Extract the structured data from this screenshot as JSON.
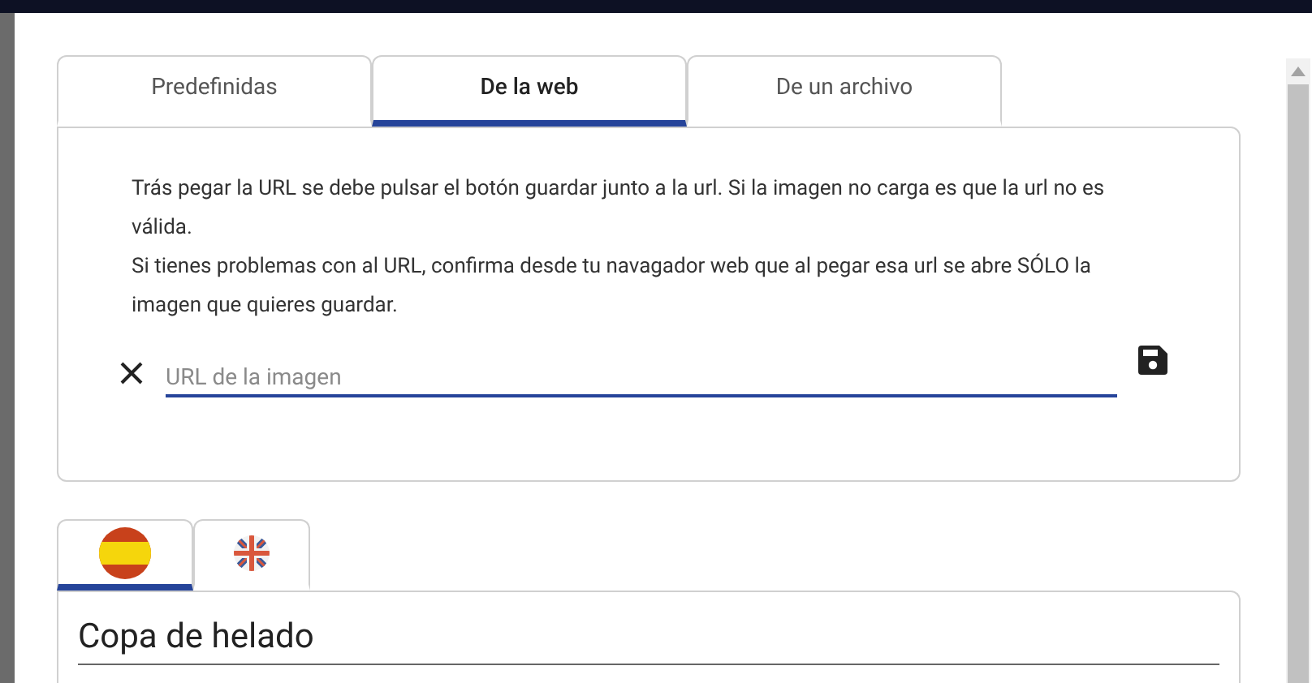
{
  "source_tabs": [
    {
      "label": "Predefinidas",
      "selected": false
    },
    {
      "label": "De la web",
      "selected": true
    },
    {
      "label": "De un archivo",
      "selected": false
    }
  ],
  "instructions": [
    "Trás pegar la URL se debe pulsar el botón guardar junto a la url. Si la imagen no carga es que la url no es válida.",
    "Si tienes problemas con al URL, confirma desde tu navagador web que al pegar esa url se abre SÓLO la imagen que quieres guardar."
  ],
  "url_field": {
    "placeholder": "URL de la imagen"
  },
  "language_tabs": [
    {
      "kind": "spain",
      "selected": true
    },
    {
      "kind": "uk",
      "selected": false
    }
  ],
  "name_field": {
    "value": "Copa de helado"
  }
}
